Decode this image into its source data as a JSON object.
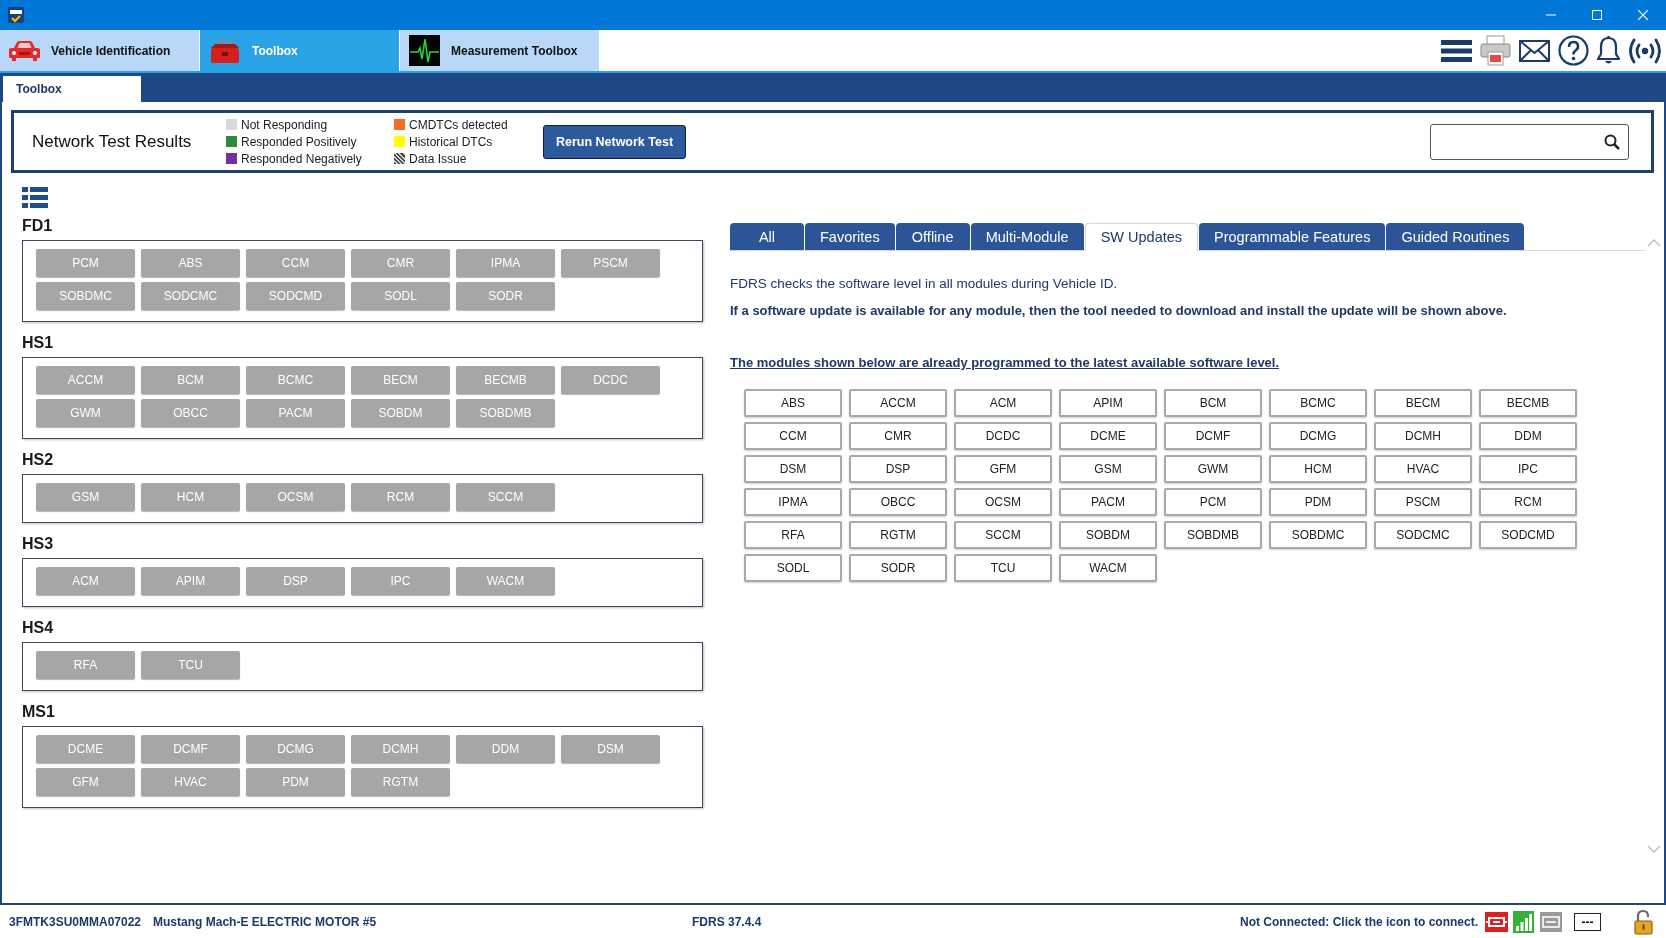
{
  "app_tabs": [
    {
      "kind": "vehicle",
      "label": "Vehicle Identification",
      "selected": false
    },
    {
      "kind": "toolbox",
      "label": "Toolbox",
      "selected": true
    },
    {
      "kind": "measurement",
      "label": "Measurement Toolbox",
      "selected": false
    }
  ],
  "sub_tabs": [
    {
      "label": "Toolbox",
      "selected": true
    }
  ],
  "network_test": {
    "title": "Network Test Results",
    "legend": [
      {
        "kind": "solid",
        "label": "Not Responding",
        "color": "#d9d9d9"
      },
      {
        "kind": "solid",
        "label": "Responded Positively",
        "color": "#2e8b3e"
      },
      {
        "kind": "solid",
        "label": "Responded Negatively",
        "color": "#7030a0"
      },
      {
        "kind": "solid",
        "label": "CMDTCs detected",
        "color": "#f26f21"
      },
      {
        "kind": "solid",
        "label": "Historical DTCs",
        "color": "#ffff00"
      },
      {
        "kind": "hatched",
        "label": "Data Issue"
      }
    ],
    "rerun_button": "Rerun Network Test"
  },
  "module_groups": [
    {
      "name": "FD1",
      "modules": [
        "PCM",
        "ABS",
        "CCM",
        "CMR",
        "IPMA",
        "PSCM",
        "SOBDMC",
        "SODCMC",
        "SODCMD",
        "SODL",
        "SODR"
      ]
    },
    {
      "name": "HS1",
      "modules": [
        "ACCM",
        "BCM",
        "BCMC",
        "BECM",
        "BECMB",
        "DCDC",
        "GWM",
        "OBCC",
        "PACM",
        "SOBDM",
        "SOBDMB"
      ]
    },
    {
      "name": "HS2",
      "modules": [
        "GSM",
        "HCM",
        "OCSM",
        "RCM",
        "SCCM"
      ]
    },
    {
      "name": "HS3",
      "modules": [
        "ACM",
        "APIM",
        "DSP",
        "IPC",
        "WACM"
      ]
    },
    {
      "name": "HS4",
      "modules": [
        "RFA",
        "TCU"
      ]
    },
    {
      "name": "MS1",
      "modules": [
        "DCME",
        "DCMF",
        "DCMG",
        "DCMH",
        "DDM",
        "DSM",
        "GFM",
        "HVAC",
        "PDM",
        "RGTM"
      ]
    }
  ],
  "module_tabs": [
    {
      "label": "All",
      "selected": false
    },
    {
      "label": "Favorites",
      "selected": false
    },
    {
      "label": "Offline",
      "selected": false
    },
    {
      "label": "Multi-Module",
      "selected": false
    },
    {
      "label": "SW Updates",
      "selected": true
    },
    {
      "label": "Programmable Features",
      "selected": false
    },
    {
      "label": "Guided Routines",
      "selected": false
    }
  ],
  "sw_updates": {
    "intro": "FDRS checks the software level in all modules during Vehicle ID.",
    "notice": "If a software update is available for any module, then the tool needed to download and install the update will be shown above.",
    "heading": "The modules shown below are already programmed to the latest available software level.",
    "modules": [
      "ABS",
      "ACCM",
      "ACM",
      "APIM",
      "BCM",
      "BCMC",
      "BECM",
      "BECMB",
      "CCM",
      "CMR",
      "DCDC",
      "DCME",
      "DCMF",
      "DCMG",
      "DCMH",
      "DDM",
      "DSM",
      "DSP",
      "GFM",
      "GSM",
      "GWM",
      "HCM",
      "HVAC",
      "IPC",
      "IPMA",
      "OBCC",
      "OCSM",
      "PACM",
      "PCM",
      "PDM",
      "PSCM",
      "RCM",
      "RFA",
      "RGTM",
      "SCCM",
      "SOBDM",
      "SOBDMB",
      "SOBDMC",
      "SODCMC",
      "SODCMD",
      "SODL",
      "SODR",
      "TCU",
      "WACM"
    ]
  },
  "status_bar": {
    "vin": "3FMTK3SU0MMA07022",
    "vehicle": "Mustang Mach-E ELECTRIC MOTOR #5",
    "version": "FDRS 37.4.4",
    "connection": "Not Connected: Click the icon to connect.",
    "indicator": "---"
  }
}
